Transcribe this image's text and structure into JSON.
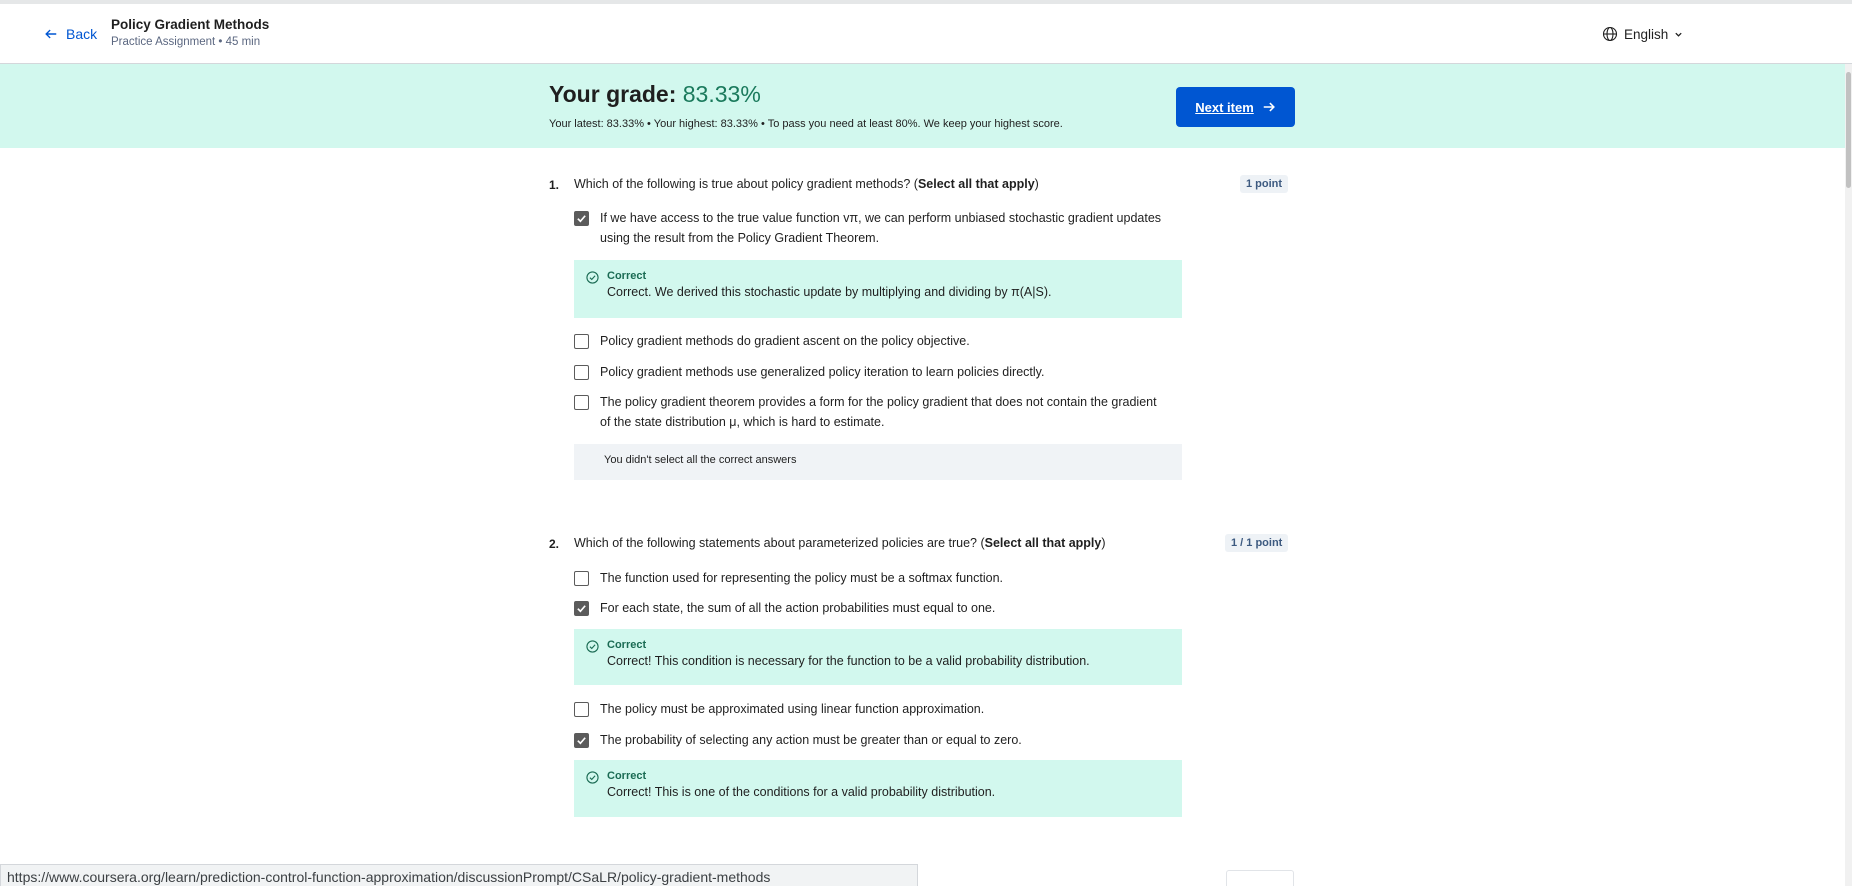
{
  "header": {
    "back_label": "Back",
    "title": "Policy Gradient Methods",
    "subtitle": "Practice Assignment • 45 min",
    "language": "English"
  },
  "grade": {
    "label": "Your grade: ",
    "value": "83.33%",
    "summary": "Your latest: 83.33%  •  Your highest: 83.33%  •  To pass you need at least 80%. We keep your highest score.",
    "next_label": "Next item"
  },
  "questions": [
    {
      "number": "1.",
      "text_prefix": "Which of the following is true about policy gradient methods? (",
      "text_bold": "Select all that apply",
      "text_suffix": ")",
      "points": "1 point",
      "options": [
        {
          "text": "If we have access to the true value function vπ, we can perform unbiased stochastic gradient updates using the result from the Policy Gradient Theorem.",
          "checked": true,
          "feedback": {
            "title": "Correct",
            "text": "Correct. We derived this stochastic update by multiplying and dividing by π(A|S)."
          }
        },
        {
          "text": "Policy gradient methods do gradient ascent on the policy objective.",
          "checked": false
        },
        {
          "text": "Policy gradient methods use generalized policy iteration to learn policies directly.",
          "checked": false
        },
        {
          "text": "The policy gradient theorem provides a form for the policy gradient that does not contain the gradient of the state distribution μ, which is hard to estimate.",
          "checked": false
        }
      ],
      "note": "You didn't select all the correct answers"
    },
    {
      "number": "2.",
      "text_prefix": "Which of the following statements about parameterized policies are true? (",
      "text_bold": "Select all that apply",
      "text_suffix": ")",
      "points": "1 / 1 point",
      "options": [
        {
          "text": "The function used for representing the policy must be a softmax function.",
          "checked": false
        },
        {
          "text": "For each state, the sum of all the action probabilities must equal to one.",
          "checked": true,
          "feedback": {
            "title": "Correct",
            "text": "Correct! This condition is necessary for the function to be a valid probability distribution."
          }
        },
        {
          "text": "The policy must be approximated using linear function approximation.",
          "checked": false
        },
        {
          "text": "The probability of selecting any action must be greater than or equal to zero.",
          "checked": true,
          "feedback": {
            "title": "Correct",
            "text": "Correct! This is one of the conditions for a valid probability distribution."
          }
        }
      ]
    }
  ],
  "status_url": "https://www.coursera.org/learn/prediction-control-function-approximation/discussionPrompt/CSaLR/policy-gradient-methods",
  "colors": {
    "primary": "#0056d2",
    "success_bg": "#d2f8ee",
    "success_text": "#1a6b53"
  }
}
